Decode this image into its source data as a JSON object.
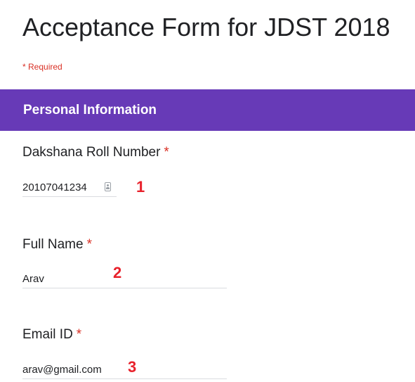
{
  "form": {
    "title": "Acceptance Form for JDST 2018",
    "required_note": "* Required"
  },
  "section": {
    "title": "Personal Information"
  },
  "questions": [
    {
      "label": "Dakshana Roll Number",
      "required_mark": "*",
      "value": "20107041234"
    },
    {
      "label": "Full Name",
      "required_mark": "*",
      "value": "Arav"
    },
    {
      "label": "Email ID",
      "required_mark": "*",
      "value": "arav@gmail.com"
    }
  ],
  "annotations": [
    "1",
    "2",
    "3"
  ],
  "icons": {
    "roll_number_field": "contact-card-icon"
  },
  "colors": {
    "accent": "#673ab7",
    "required": "#d93025",
    "annotation": "#e8212b"
  }
}
